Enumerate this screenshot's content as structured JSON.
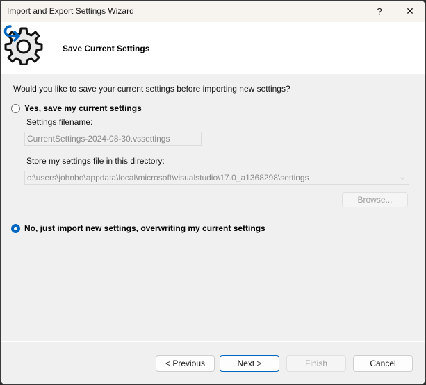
{
  "window": {
    "title": "Import and Export Settings Wizard",
    "help_label": "?",
    "close_label": "✕"
  },
  "header": {
    "title": "Save Current Settings",
    "icon": "settings-gear-with-arrow-icon"
  },
  "content": {
    "question": "Would you like to save your current settings before importing new settings?",
    "options": [
      {
        "label": "Yes, save my current settings",
        "selected": false
      },
      {
        "label": "No, just import new settings, overwriting my current settings",
        "selected": true
      }
    ],
    "filename_label": "Settings filename:",
    "filename_value": "CurrentSettings-2024-08-30.vssettings",
    "directory_label": "Store my settings file in this directory:",
    "directory_value": "c:\\users\\johnbo\\appdata\\local\\microsoft\\visualstudio\\17.0_a1368298\\settings",
    "browse_label": "Browse..."
  },
  "footer": {
    "previous_label": "< Previous",
    "next_label": "Next >",
    "finish_label": "Finish",
    "cancel_label": "Cancel"
  },
  "colors": {
    "accent": "#0067c0",
    "titlebar": "#f7f3ee",
    "body": "#f0f0f0"
  }
}
